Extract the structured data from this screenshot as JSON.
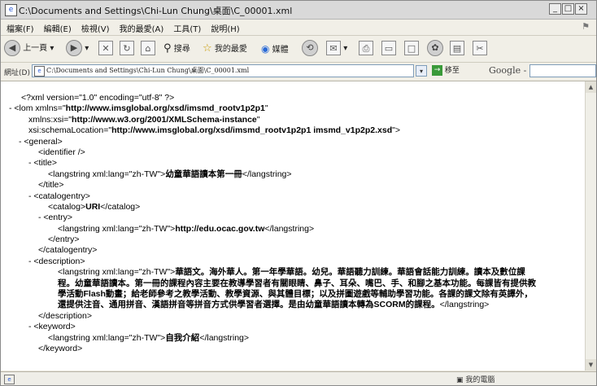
{
  "window": {
    "title": "C:\\Documents and Settings\\Chi-Lun Chung\\桌面\\C_00001.xml",
    "minimize_label": "_",
    "restore_label": "□",
    "close_label": "×"
  },
  "menu": {
    "items": [
      "檔案(F)",
      "編輯(E)",
      "檢視(V)",
      "我的最愛(A)",
      "工具(T)",
      "說明(H)"
    ]
  },
  "toolbar": {
    "back_label": "上一頁",
    "search_label": "搜尋",
    "favorites_label": "我的最愛",
    "media_label": "媒體"
  },
  "address": {
    "label": "網址(D)",
    "value": "C:\\Documents and Settings\\Chi-Lun Chung\\桌面\\C_00001.xml",
    "go_label": "移至",
    "search_provider": "Google -"
  },
  "xml": {
    "decl": "<?xml version=\"1.0\" encoding=\"utf-8\" ?>",
    "lom_open_start": "<lom xmlns=\"",
    "lom_xmlns": "http://www.imsglobal.org/xsd/imsmd_rootv1p2p1",
    "lom_open_q": "\"",
    "xsi_attr": "xmlns:xsi=\"",
    "xsi_val": "http://www.w3.org/2001/XMLSchema-instance",
    "xsi_close": "\"",
    "schema_attr": "xsi:schemaLocation=\"",
    "schema_val": "http://www.imsglobal.org/xsd/imsmd_rootv1p2p1 imsmd_v1p2p2.xsd",
    "schema_close": "\">",
    "general_open": "<general>",
    "identifier": "<identifier />",
    "title_open": "<title>",
    "ls_open": "<langstring xml:lang=\"zh-TW\">",
    "ls_close": "</langstring>",
    "title_text": "幼童華語讀本第一冊",
    "title_close": "</title>",
    "catalogentry_open": "<catalogentry>",
    "catalog_open": "<catalog>",
    "catalog_text": "URI",
    "catalog_close": "</catalog>",
    "entry_open": "<entry>",
    "entry_text": "http://edu.ocac.gov.tw",
    "entry_close": "</entry>",
    "catalogentry_close": "</catalogentry>",
    "description_open": "<description>",
    "description_text": "華語文。海外華人。第一年學華語。幼兒。華語聽力訓練。華語會話能力訓練。讀本及數位課程。幼童華語讀本。第一冊的課程內容主要在教導學習者有關眼睛、鼻子、耳朵、嘴巴、手、和腳之基本功能。每課皆有提供教學活動Flash動畫；給老師參考之教學活動、教學資源、與其體目標；以及拼圖遊戲等輔助學習功能。各課的課文除有英譯外，還提供注音、通用拼音、漢語拼音等拼音方式供學習者選擇。是由幼童華語讀本轉為SCORM的課程。",
    "description_close": "</description>",
    "keyword_open": "<keyword>",
    "keyword_text": "自我介紹",
    "keyword_close": "</keyword>",
    "minus": "-"
  },
  "status": {
    "zone": "我的電腦"
  }
}
